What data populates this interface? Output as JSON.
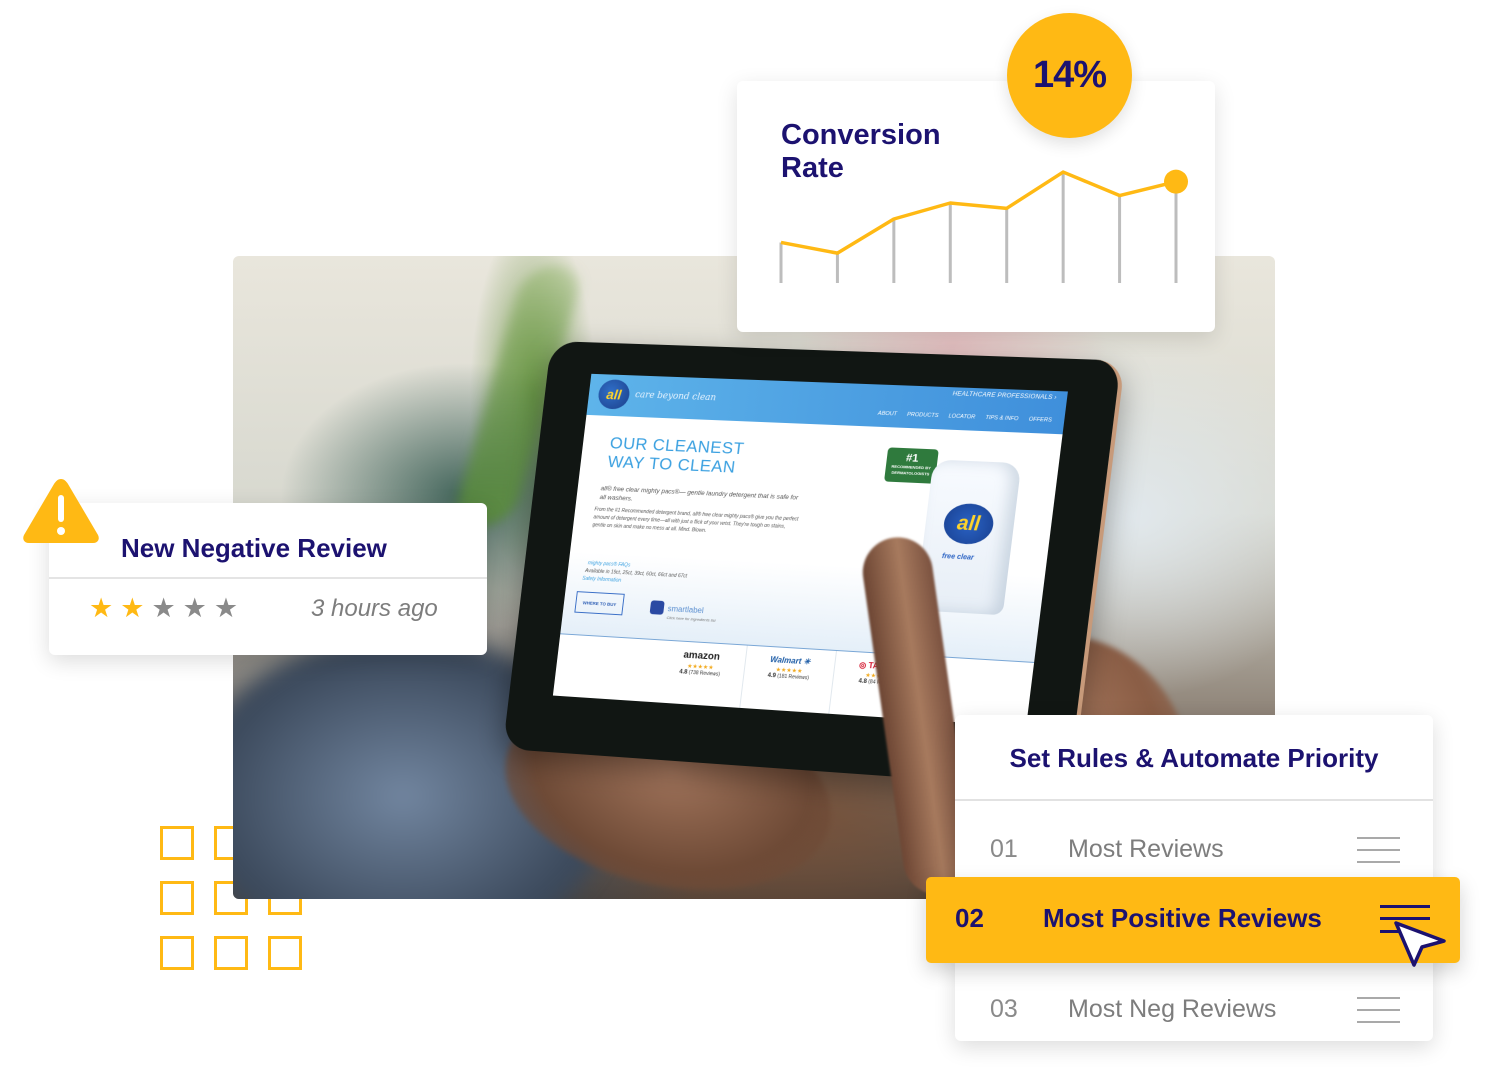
{
  "colors": {
    "accent": "#ffb914",
    "navy": "#1c1270",
    "muted_text": "#7d7d7d",
    "star_off": "#8a8a8a",
    "chart_stem": "#bdbdbd"
  },
  "conversion_card": {
    "title": "Conversion Rate",
    "badge": "14%",
    "chart_data": {
      "type": "line",
      "title": "Conversion Rate",
      "x": [
        1,
        2,
        3,
        4,
        5,
        6,
        7,
        8
      ],
      "values": [
        38,
        28,
        60,
        75,
        70,
        104,
        82,
        95
      ],
      "ylim": [
        0,
        120
      ],
      "grid": false,
      "highlight_last_point": true,
      "series_color": "#ffb914",
      "stem_color": "#bdbdbd"
    }
  },
  "review_card": {
    "title": "New Negative Review",
    "rating": 2,
    "max_rating": 5,
    "time": "3 hours ago",
    "icon": "warning-triangle-icon"
  },
  "priority_card": {
    "title": "Set Rules & Automate Priority",
    "rows": [
      {
        "num": "01",
        "label": "Most Reviews",
        "active": false
      },
      {
        "num": "02",
        "label": "Most Positive Reviews",
        "active": true
      },
      {
        "num": "03",
        "label": "Most Neg Reviews",
        "active": false
      }
    ],
    "handle_icon": "drag-handle-icon",
    "cursor_icon": "mouse-pointer-icon"
  },
  "tablet_site": {
    "logo": "all",
    "tagline": "care beyond clean",
    "top_link": "HEALTHCARE PROFESSIONALS ›",
    "nav": [
      "ABOUT",
      "PRODUCTS",
      "LOCATOR",
      "TIPS & INFO",
      "OFFERS"
    ],
    "hero": [
      "OUR CLEANEST",
      "WAY TO CLEAN"
    ],
    "subhead": "all® free clear mighty pacs®— gentle laundry detergent that is safe for all washers.",
    "body": "From the #1 Recommended detergent brand, all® free clear mighty pacs® give you the perfect amount of detergent every time—all with just a flick of your wrist. They're tough on stains, gentle on skin and make no mess at all. Mind. Blown.",
    "faq_link": "mighty pacs® FAQs",
    "availability": "Available in 19ct, 25ct, 39ct, 60ct, 66ct and 67ct",
    "safety_link": "Safety Information",
    "where_to_buy": "WHERE TO BUY",
    "smartlabel": "smartlabel",
    "smartlabel_sub": "Click here for ingredients list",
    "badge_rank": "#1",
    "badge_text": "RECOMMENDED BY DERMATOLOGISTS",
    "product_logo": "all",
    "product_label": "free clear",
    "retailers": [
      {
        "name": "amazon",
        "stars": "★★★★★",
        "score": "4.8",
        "reviews": "(738 Reviews)"
      },
      {
        "name": "Walmart ✳",
        "stars": "★★★★★",
        "score": "4.9",
        "reviews": "(181 Reviews)"
      },
      {
        "name": "◎ TARGET",
        "stars": "★★★★★",
        "score": "4.8",
        "reviews": "(84 Reviews)"
      }
    ]
  }
}
